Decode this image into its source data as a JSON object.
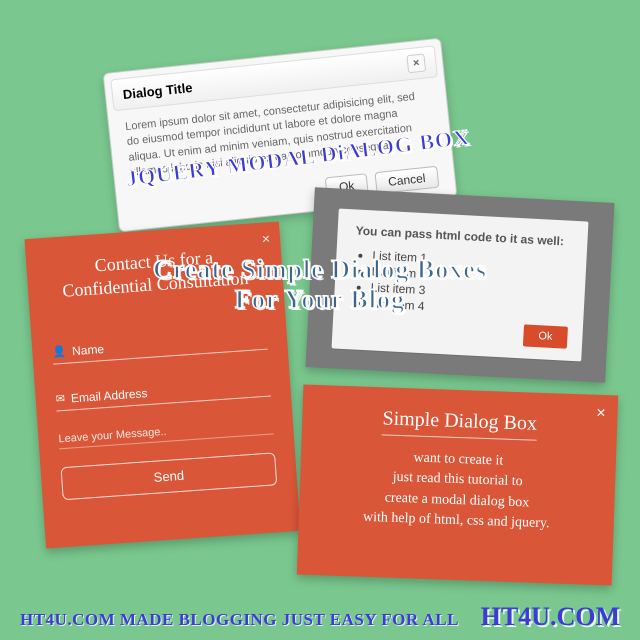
{
  "card1": {
    "title": "Dialog Title",
    "body": "Lorem ipsum dolor sit amet, consectetur adipisicing elit, sed do eiusmod tempor incididunt ut labore et dolore magna aliqua. Ut enim ad minim veniam, quis nostrud exercitation ullamco laboris nisi aliquip ex ea commodo consequat.",
    "ok": "Ok",
    "cancel": "Cancel",
    "close": "×"
  },
  "overlay_jquery": "JQUERY MODAL DiALOG BOX",
  "card2": {
    "heading": "You can pass html code to it as well:",
    "items": [
      "List item 1",
      "List item 2",
      "List item 3",
      "List item 4"
    ],
    "ok": "Ok"
  },
  "card3": {
    "close": "×",
    "heading_l1": "Contact Us for a",
    "heading_l2": "Confidential Consultation",
    "name_label": "Name",
    "email_label": "Email Address",
    "message_placeholder": "Leave your Message..",
    "send": "Send"
  },
  "card4": {
    "close": "×",
    "title": "Simple Dialog Box",
    "l1": "want to create it",
    "l2": "just read this tutorial to",
    "l3": "create a modal dialog box",
    "l4": "with help of html, css and jquery."
  },
  "main_overlay_l1": "Create Simple Dialog Boxes",
  "main_overlay_l2": "For Your Blog",
  "tagline": "HT4U.COM MADE BLOGGING JUST EASY FOR ALL",
  "brand": "HT4U.COM"
}
